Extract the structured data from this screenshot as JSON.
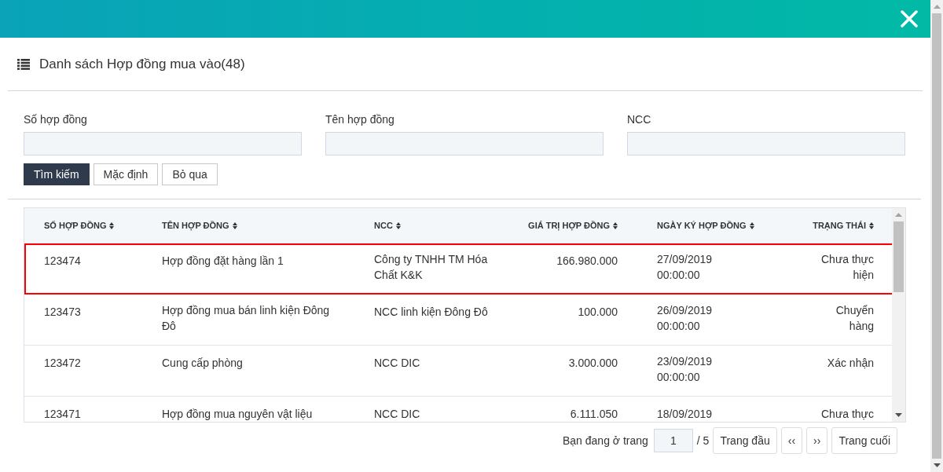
{
  "title": "Danh sách Hợp đồng mua vào(48)",
  "filters": [
    {
      "label": "Số hợp đồng"
    },
    {
      "label": "Tên hợp đồng"
    },
    {
      "label": "NCC"
    }
  ],
  "buttons": [
    {
      "label": "Tìm kiếm",
      "kind": "primary"
    },
    {
      "label": "Mặc định",
      "kind": "default"
    },
    {
      "label": "Bỏ qua",
      "kind": "default"
    }
  ],
  "table": {
    "columns": [
      {
        "label": "SỐ HỢP ĐỒNG"
      },
      {
        "label": "TÊN HỢP ĐỒNG"
      },
      {
        "label": "NCC"
      },
      {
        "label": "GIÁ TRỊ HỢP ĐỒNG"
      },
      {
        "label": "NGÀY KÝ HỢP ĐỒNG"
      },
      {
        "label": "TRẠNG THÁI"
      }
    ],
    "rows": [
      {
        "selected": true,
        "cells": [
          "123474",
          "Hợp đồng đặt hàng lần 1",
          "Công ty TNHH TM Hóa Chất K&K",
          "166.980.000",
          "27/09/2019 00:00:00",
          "Chưa thực hiện"
        ]
      },
      {
        "selected": false,
        "cells": [
          "123473",
          "Hợp đồng mua bán linh kiện Đông Đô",
          "NCC linh kiện Đông Đô",
          "100.000",
          "26/09/2019 00:00:00",
          "Chuyển hàng"
        ]
      },
      {
        "selected": false,
        "cells": [
          "123472",
          "Cung cấp phòng",
          "NCC DIC",
          "3.000.000",
          "23/09/2019 00:00:00",
          "Xác nhận"
        ]
      },
      {
        "selected": false,
        "cells": [
          "123471",
          "Hợp đồng mua nguyên vật liệu",
          "NCC DIC",
          "6.111.050",
          "18/09/2019",
          "Chưa thực"
        ]
      }
    ]
  },
  "pagination": {
    "prefix": "Bạn đang ở trang",
    "page": "1",
    "total": "/ 5",
    "buttons": [
      "Trang đầu",
      "‹‹",
      "››",
      "Trang cuối"
    ]
  }
}
